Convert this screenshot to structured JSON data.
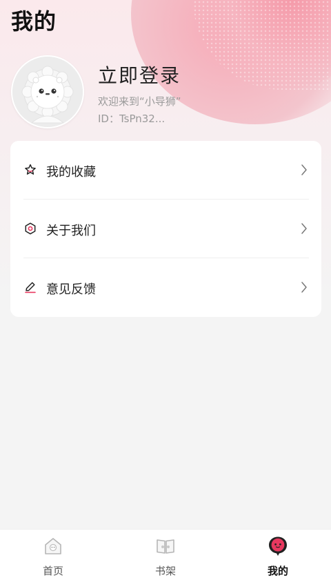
{
  "page": {
    "title": "我的"
  },
  "profile": {
    "login_text": "立即登录",
    "welcome_text": "欢迎来到“小导狮”",
    "id_text": "ID：TsPn32..."
  },
  "menu": [
    {
      "label": "我的收藏",
      "icon": "star-icon"
    },
    {
      "label": "关于我们",
      "icon": "hexagon-icon"
    },
    {
      "label": "意见反馈",
      "icon": "pencil-icon"
    }
  ],
  "tabbar": {
    "items": [
      {
        "label": "首页",
        "icon": "home-icon",
        "active": false
      },
      {
        "label": "书架",
        "icon": "bookshelf-icon",
        "active": false
      },
      {
        "label": "我的",
        "icon": "profile-icon",
        "active": true
      }
    ]
  },
  "colors": {
    "accent": "#e8385f",
    "tab_inactive_text": "#555555",
    "tab_active_text": "#111111",
    "hero_pink": "#f59aa9"
  }
}
